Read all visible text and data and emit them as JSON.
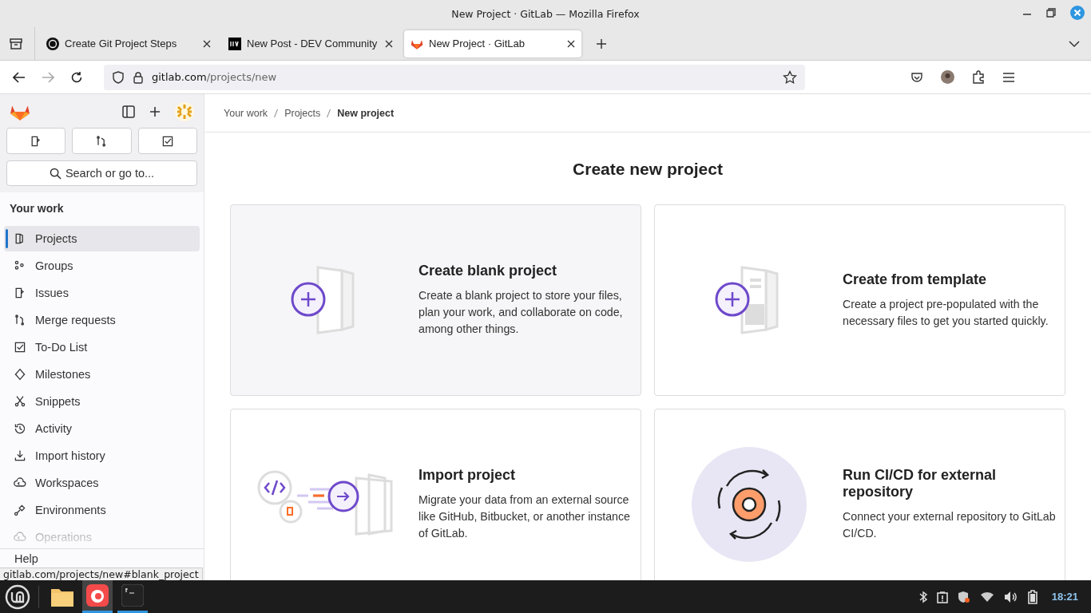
{
  "window": {
    "title": "New Project · GitLab — Mozilla Firefox"
  },
  "tabs": [
    {
      "label": "Create Git Project Steps",
      "selected": false,
      "kind": "chat"
    },
    {
      "label": "New Post - DEV Community",
      "selected": false,
      "kind": "dev"
    },
    {
      "label": "New Project · GitLab",
      "selected": true,
      "kind": "gitlab"
    }
  ],
  "address": {
    "host": "gitlab.com",
    "path": "/projects/new"
  },
  "sidebar": {
    "search": {
      "placeholder": "Search or go to..."
    },
    "section": "Your work",
    "items": [
      {
        "label": "Projects",
        "selected": true,
        "kind": "project"
      },
      {
        "label": "Groups",
        "selected": false,
        "kind": "group"
      },
      {
        "label": "Issues",
        "selected": false,
        "kind": "issue"
      },
      {
        "label": "Merge requests",
        "selected": false,
        "kind": "merge"
      },
      {
        "label": "To-Do List",
        "selected": false,
        "kind": "todo"
      },
      {
        "label": "Milestones",
        "selected": false,
        "kind": "milestone"
      },
      {
        "label": "Snippets",
        "selected": false,
        "kind": "snippet"
      },
      {
        "label": "Activity",
        "selected": false,
        "kind": "history"
      },
      {
        "label": "Import history",
        "selected": false,
        "kind": "import"
      },
      {
        "label": "Workspaces",
        "selected": false,
        "kind": "cloud"
      },
      {
        "label": "Environments",
        "selected": false,
        "kind": "env"
      },
      {
        "label": "Operations",
        "selected": false,
        "kind": "cloud"
      }
    ],
    "help": "Help"
  },
  "breadcrumb": [
    "Your work",
    "Projects",
    "New project"
  ],
  "heading": "Create new project",
  "cards": [
    {
      "kind": "blank",
      "title": "Create blank project",
      "description": "Create a blank project to store your files, plan your work, and collaborate on code, among other things."
    },
    {
      "kind": "template",
      "title": "Create from template",
      "description": "Create a project pre-populated with the necessary files to get you started quickly."
    },
    {
      "kind": "import",
      "title": "Import project",
      "description": "Migrate your data from an external source like GitHub, Bitbucket, or another instance of GitLab."
    },
    {
      "kind": "cicd",
      "title": "Run CI/CD for external repository",
      "description": "Connect your external repository to GitLab CI/CD."
    }
  ],
  "status_link": "gitlab.com/projects/new#blank_project",
  "taskbar": {
    "clock": "18:21"
  }
}
